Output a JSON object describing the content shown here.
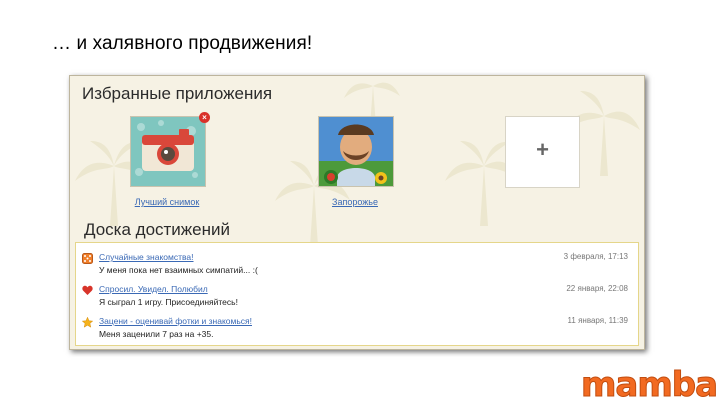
{
  "slide": {
    "title": "… и халявного продвижения!"
  },
  "favorites": {
    "title": "Избранные приложения",
    "apps": [
      {
        "caption": "Лучший снимок",
        "icon": "camera-icon",
        "removable": true
      },
      {
        "caption": "Запорожье",
        "icon": "farmer-game-icon",
        "removable": false
      }
    ],
    "remove_glyph": "×",
    "add_glyph": "+"
  },
  "achievements": {
    "title": "Доска достижений",
    "items": [
      {
        "link": "Случайные знакомства!",
        "text": "У меня пока нет взаимных симпатий... :(",
        "date": "3 февраля, 17:13",
        "icon": "dice-icon"
      },
      {
        "link": "Спросил. Увидел. Полюбил",
        "text": "Я сыграл 1 игру. Присоединяйтесь!",
        "date": "22 января, 22:08",
        "icon": "heart-icon"
      },
      {
        "link": "Зацени - оценивай фотки и знакомься!",
        "text": "Меня заценили 7 раз на +35.",
        "date": "11 января, 11:39",
        "icon": "star-icon"
      }
    ]
  },
  "brand": {
    "logo_text": "mamba",
    "color": "#f26a21"
  }
}
